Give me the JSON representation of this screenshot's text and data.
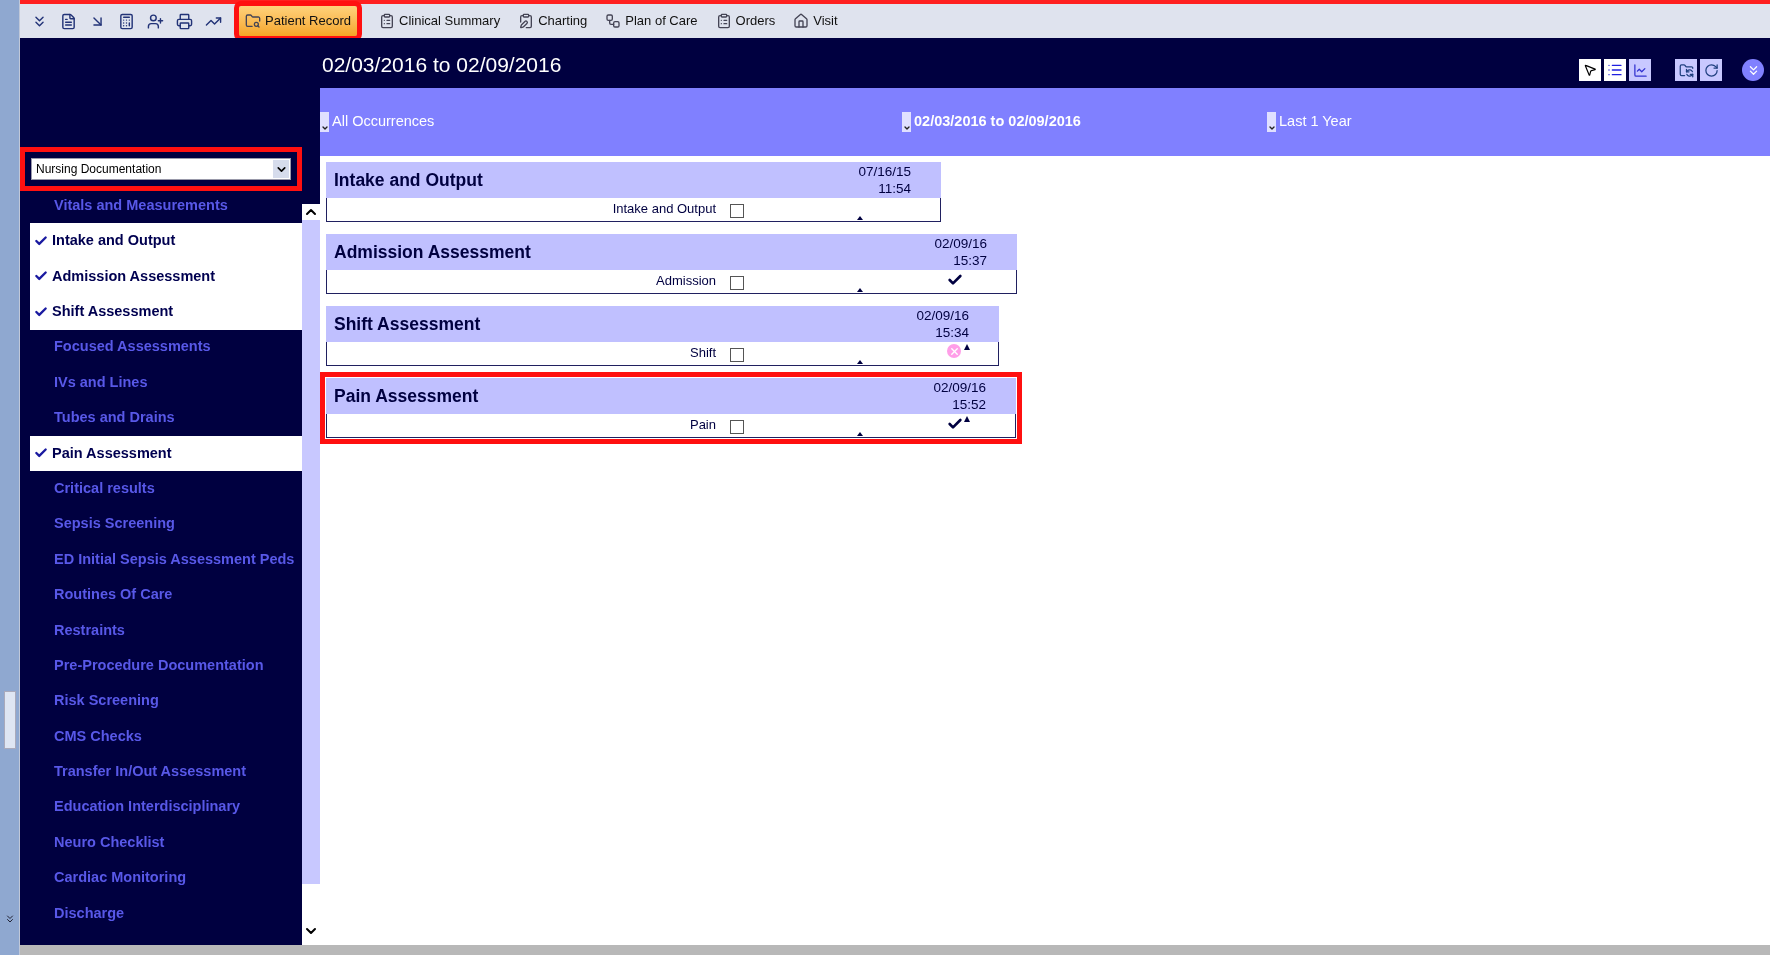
{
  "toolbar": {
    "tabs": [
      {
        "label": "Patient Record",
        "selected": true,
        "highlighted": true
      },
      {
        "label": "Clinical Summary",
        "selected": false,
        "highlighted": false
      },
      {
        "label": "Charting",
        "selected": false,
        "highlighted": false
      },
      {
        "label": "Plan of Care",
        "selected": false,
        "highlighted": false
      },
      {
        "label": "Orders",
        "selected": false,
        "highlighted": false
      },
      {
        "label": "Visit",
        "selected": false,
        "highlighted": false
      }
    ]
  },
  "header": {
    "title": "02/03/2016 to 02/09/2016"
  },
  "filter_bar": [
    {
      "label": "All Occurrences",
      "selected": false
    },
    {
      "label": "02/03/2016 to 02/09/2016",
      "selected": true
    },
    {
      "label": "Last 1 Year",
      "selected": false
    }
  ],
  "sidebar": {
    "dropdown": {
      "value": "Nursing Documentation",
      "highlighted": true
    },
    "items": [
      {
        "label": "Vitals and Measurements",
        "checked": false
      },
      {
        "label": "Intake and Output",
        "checked": true
      },
      {
        "label": "Admission Assessment",
        "checked": true
      },
      {
        "label": "Shift Assessment",
        "checked": true
      },
      {
        "label": "Focused Assessments",
        "checked": false
      },
      {
        "label": "IVs and Lines",
        "checked": false
      },
      {
        "label": "Tubes and Drains",
        "checked": false
      },
      {
        "label": "Pain Assessment",
        "checked": true
      },
      {
        "label": "Critical results",
        "checked": false
      },
      {
        "label": "Sepsis Screening",
        "checked": false
      },
      {
        "label": "ED Initial Sepsis Assessment Peds",
        "checked": false
      },
      {
        "label": "Routines Of Care",
        "checked": false
      },
      {
        "label": "Restraints",
        "checked": false
      },
      {
        "label": "Pre-Procedure Documentation",
        "checked": false
      },
      {
        "label": "Risk Screening",
        "checked": false
      },
      {
        "label": "CMS Checks",
        "checked": false
      },
      {
        "label": "Transfer In/Out Assessment",
        "checked": false
      },
      {
        "label": "Education Interdisciplinary",
        "checked": false
      },
      {
        "label": "Neuro Checklist",
        "checked": false
      },
      {
        "label": "Cardiac Monitoring",
        "checked": false
      },
      {
        "label": "Discharge",
        "checked": false
      }
    ]
  },
  "sections": [
    {
      "title": "Intake and Output",
      "date": "07/16/15",
      "time": "11:54",
      "row_label": "Intake and Output",
      "checked": false,
      "done": false,
      "error": false,
      "flag": false,
      "highlighted": false
    },
    {
      "title": "Admission Assessment",
      "date": "02/09/16",
      "time": "15:37",
      "row_label": "Admission",
      "checked": false,
      "done": true,
      "error": false,
      "flag": false,
      "highlighted": false
    },
    {
      "title": "Shift Assessment",
      "date": "02/09/16",
      "time": "15:34",
      "row_label": "Shift",
      "checked": false,
      "done": false,
      "error": true,
      "flag": true,
      "highlighted": false
    },
    {
      "title": "Pain Assessment",
      "date": "02/09/16",
      "time": "15:52",
      "row_label": "Pain",
      "checked": false,
      "done": true,
      "error": false,
      "flag": true,
      "highlighted": true
    }
  ]
}
